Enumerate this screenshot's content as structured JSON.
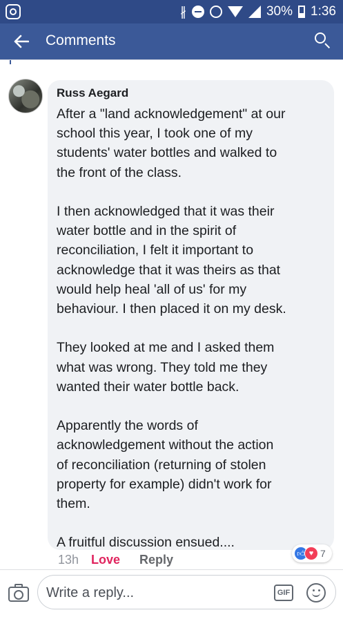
{
  "status_bar": {
    "battery": "30%",
    "time": "1:36",
    "icons": [
      "instagram-icon",
      "bluetooth-icon",
      "do-not-disturb-icon",
      "alarm-icon",
      "wifi-icon",
      "signal-icon",
      "battery-icon"
    ]
  },
  "header": {
    "title": "Comments",
    "back_icon": "arrow-left-icon",
    "search_icon": "search-icon",
    "background": "#3b5998"
  },
  "comment": {
    "author": "Russ Aegard",
    "lines": [
      "After a \"land acknowledgement\" at our",
      "school this year, I took one of my",
      "students' water bottles and walked to",
      "the front of the class.",
      "",
      "I then acknowledged that it was their",
      "water bottle and in the spirit of",
      "reconciliation, I felt it important to",
      "acknowledge that it was theirs as that",
      "would help heal 'all of us' for my",
      "behaviour.  I then placed it on my desk.",
      "",
      "They looked at me and I asked them",
      "what was wrong.  They told me they",
      "wanted their water bottle back.",
      "",
      "Apparently the words of",
      "acknowledgement without the action",
      "of reconciliation (returning of stolen",
      "property for example) didn't work for",
      "them.",
      "",
      "A fruitful discussion ensued...."
    ],
    "time": "13h",
    "love_label": "Love",
    "reply_label": "Reply",
    "reaction_count": "7",
    "reaction_icons": [
      "like-icon",
      "heart-icon"
    ],
    "love_color": "#e0245e"
  },
  "composer": {
    "placeholder": "Write a reply...",
    "gif_label": "GIF",
    "camera_icon": "camera-icon",
    "emoji_icon": "smiley-icon"
  }
}
